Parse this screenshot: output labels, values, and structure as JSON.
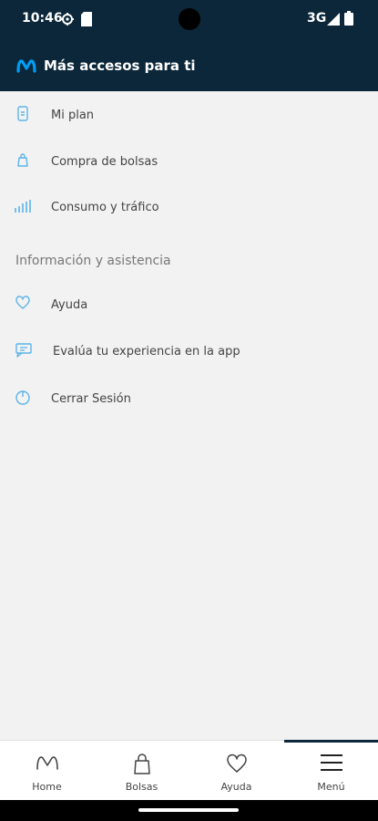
{
  "status_bar": {
    "time": "10:46",
    "network": "3G",
    "icons": [
      "settings-icon",
      "sim-card-icon",
      "signal-icon",
      "battery-icon"
    ]
  },
  "header": {
    "logo_icon": "movistar-m-logo",
    "title": "Más accesos para ti"
  },
  "menu_items": [
    {
      "label": "Mi plan",
      "icon": "phone-plan-icon"
    },
    {
      "label": "Compra de bolsas",
      "icon": "shopping-bag-icon"
    },
    {
      "label": "Consumo y tráfico",
      "icon": "bar-chart-icon"
    }
  ],
  "section_info": {
    "title": "Información y asistencia",
    "items": [
      {
        "label": "Ayuda",
        "icon": "heart-icon"
      },
      {
        "label": "Evalúa tu experiencia en la app",
        "icon": "feedback-icon"
      },
      {
        "label": "Cerrar Sesión",
        "icon": "power-icon"
      }
    ]
  },
  "bottom_nav": {
    "tabs": [
      {
        "label": "Home",
        "icon": "movistar-m-icon",
        "active": false
      },
      {
        "label": "Bolsas",
        "icon": "shopping-bag-icon",
        "active": false
      },
      {
        "label": "Ayuda",
        "icon": "heart-icon",
        "active": false
      },
      {
        "label": "Menú",
        "icon": "hamburger-menu-icon",
        "active": true
      }
    ]
  },
  "colors": {
    "header_bg": "#0b2739",
    "accent_icon": "#5bb4e8",
    "page_bg": "#f2f2f2",
    "logo_blue": "#019df4"
  }
}
